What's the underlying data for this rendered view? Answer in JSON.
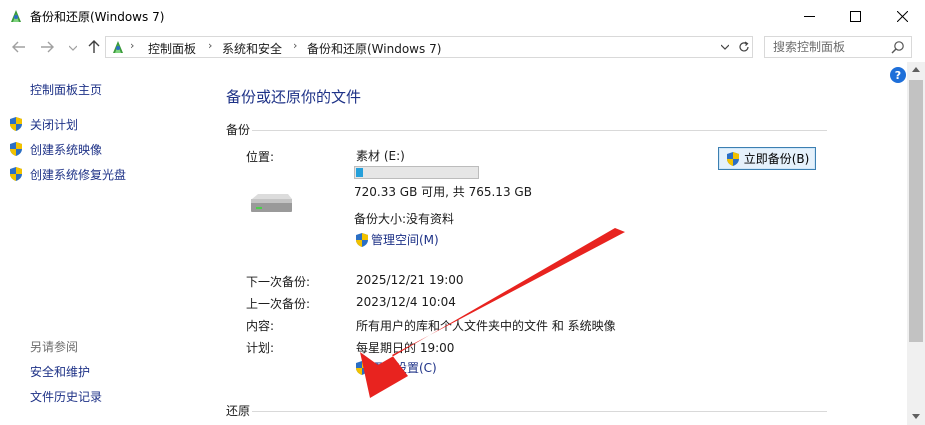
{
  "window": {
    "title": "备份和还原(Windows 7)"
  },
  "address": {
    "crumbs": [
      "控制面板",
      "系统和安全",
      "备份和还原(Windows 7)"
    ]
  },
  "search": {
    "placeholder": "搜索控制面板"
  },
  "leftnav": {
    "home": "控制面板主页",
    "items": [
      "关闭计划",
      "创建系统映像",
      "创建系统修复光盘"
    ],
    "see_also": "另请参阅",
    "links": [
      "安全和维护",
      "文件历史记录"
    ]
  },
  "main": {
    "title": "备份或还原你的文件",
    "backup_section": "备份",
    "restore_section": "还原",
    "location_label": "位置:",
    "location_value": "素材 (E:)",
    "storage_used_fraction": 0.058,
    "free_space": "720.33 GB 可用, 共 765.13 GB",
    "backup_size": "备份大小:没有资料",
    "manage_space": "管理空间(M)",
    "backup_now": "立即备份(B)",
    "next_backup_label": "下一次备份:",
    "next_backup_value": "2025/12/21 19:00",
    "last_backup_label": "上一次备份:",
    "last_backup_value": "2023/12/4 10:04",
    "contents_label": "内容:",
    "contents_value": "所有用户的库和个人文件夹中的文件 和 系统映像",
    "schedule_label": "计划:",
    "schedule_value": "每星期日的 19:00",
    "change_settings": "更改设置(C)"
  },
  "colors": {
    "link": "#1e3287",
    "progress": "#26a0da",
    "arrow": "#e8231f"
  }
}
